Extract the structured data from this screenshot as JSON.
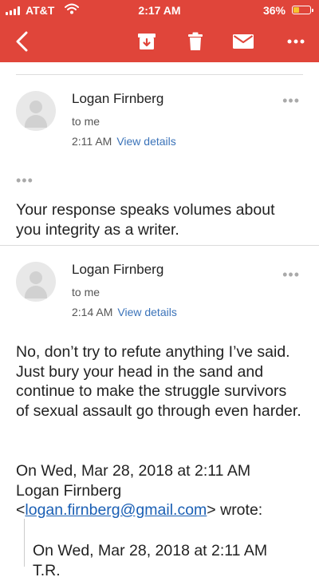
{
  "status_bar": {
    "carrier": "AT&T",
    "time": "2:17 AM",
    "battery_percent": "36%",
    "battery_level": 0.36,
    "battery_color": "#f4c430"
  },
  "toolbar": {
    "background_color": "#e0453a",
    "icons": [
      "back-icon",
      "archive-icon",
      "delete-icon",
      "mail-icon",
      "more-icon"
    ]
  },
  "messages": [
    {
      "sender": "Logan Firnberg",
      "recipient": "to me",
      "time": "2:11 AM",
      "details_label": "View details",
      "body": "Your response speaks volumes about you integrity as a writer."
    },
    {
      "sender": "Logan Firnberg",
      "recipient": "to me",
      "time": "2:14 AM",
      "details_label": "View details",
      "body": "No, don’t try to refute anything I’ve said. Just bury your head in the sand and continue to make the struggle survivors of sexual assault go through even harder.",
      "quote_intro_line1": "On Wed, Mar 28, 2018 at 2:11 AM",
      "quote_intro_line2": "Logan Firnberg",
      "quote_email": "logan.firnberg@gmail.com",
      "quote_intro_end": "wrote:",
      "nested_quote_line1": "On Wed, Mar 28, 2018 at 2:11 AM",
      "nested_quote_line2_partial": "T.R."
    }
  ]
}
